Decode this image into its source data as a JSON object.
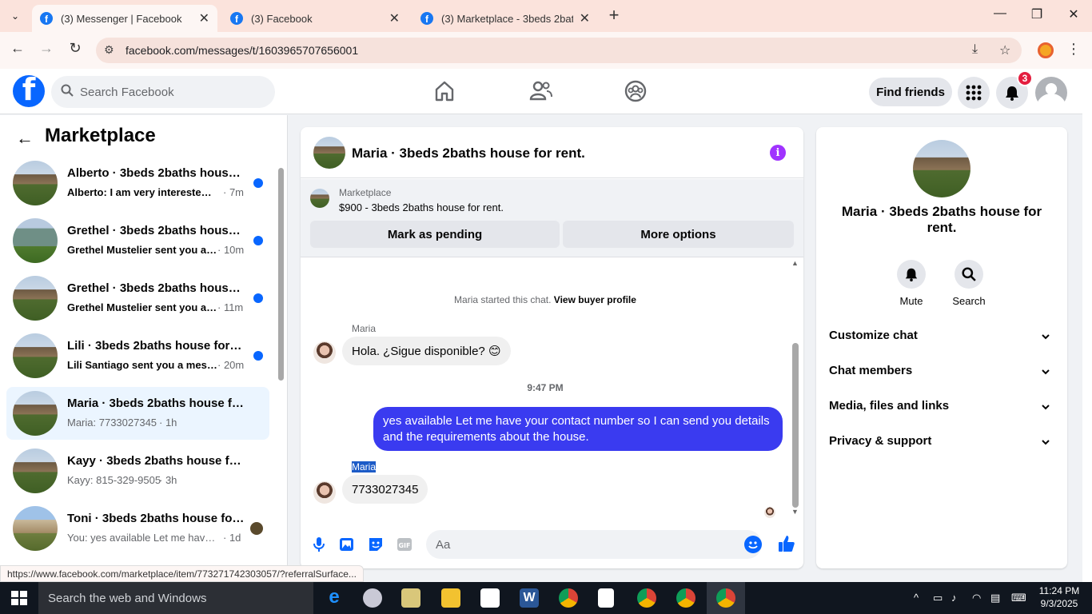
{
  "browser": {
    "tabs": [
      {
        "title": "(3) Messenger | Facebook",
        "active": true
      },
      {
        "title": "(3) Facebook",
        "active": false
      },
      {
        "title": "(3) Marketplace - 3beds 2baths",
        "active": false
      }
    ],
    "url": "facebook.com/messages/t/1603965707656001",
    "status_url": "https://www.facebook.com/marketplace/item/773271742303057/?referralSurface..."
  },
  "fb": {
    "search_placeholder": "Search Facebook",
    "find_friends": "Find friends",
    "notif_count": "3"
  },
  "sidebar": {
    "title": "Marketplace",
    "conversations": [
      {
        "name": "Alberto · 3beds 2baths house f...",
        "snippet": "Alberto: I am very interested in ...",
        "time": "· 7m",
        "unread": true
      },
      {
        "name": "Grethel · 3beds 2baths house f...",
        "snippet": "Grethel Mustelier sent you a ...",
        "time": "· 10m",
        "unread": true
      },
      {
        "name": "Grethel · 3beds 2baths house f...",
        "snippet": "Grethel Mustelier sent you a ...",
        "time": "· 11m",
        "unread": true
      },
      {
        "name": "Lili · 3beds 2baths house for re...",
        "snippet": "Lili Santiago sent you a messa...",
        "time": "· 20m",
        "unread": true
      },
      {
        "name": "Maria · 3beds 2baths house for r...",
        "snippet": "Maria: 7733027345",
        "time": "· 1h",
        "unread": false,
        "selected": true
      },
      {
        "name": "Kayy · 3beds 2baths house for r...",
        "snippet": "Kayy: 815-329-9505",
        "time": "· 3h",
        "unread": false
      },
      {
        "name": "Toni · 3beds 2baths house for ...",
        "snippet": "You: yes available Let me have y...",
        "time": "· 1d",
        "unread": false
      }
    ]
  },
  "chat": {
    "title": "Maria · 3beds 2baths house for rent.",
    "marketplace_label": "Marketplace",
    "listing": "$900 - 3beds 2baths house for rent.",
    "mark_pending": "Mark as pending",
    "more_options": "More options",
    "started_text": "Maria started this chat.",
    "view_buyer": "View buyer profile",
    "sender1": "Maria",
    "msg1": "Hola. ¿Sigue disponible? 😊",
    "timestamp": "9:47 PM",
    "msg_out": "yes available Let me have your contact number so I can send you details and the requirements about the  house.",
    "sender2": "Maria",
    "msg2": "7733027345",
    "composer_placeholder": "Aa"
  },
  "info": {
    "name": "Maria · 3beds 2baths house for rent.",
    "mute": "Mute",
    "search": "Search",
    "sections": [
      "Customize chat",
      "Chat members",
      "Media, files and links",
      "Privacy & support"
    ]
  },
  "taskbar": {
    "search_placeholder": "Search the web and Windows",
    "time": "11:24 PM",
    "date": "9/3/2025"
  },
  "colors": {
    "fb_blue": "#0866ff",
    "outgoing_bubble": "#3a3bf0",
    "selected_conv": "#ebf5ff",
    "notif_red": "#e41e3f"
  }
}
